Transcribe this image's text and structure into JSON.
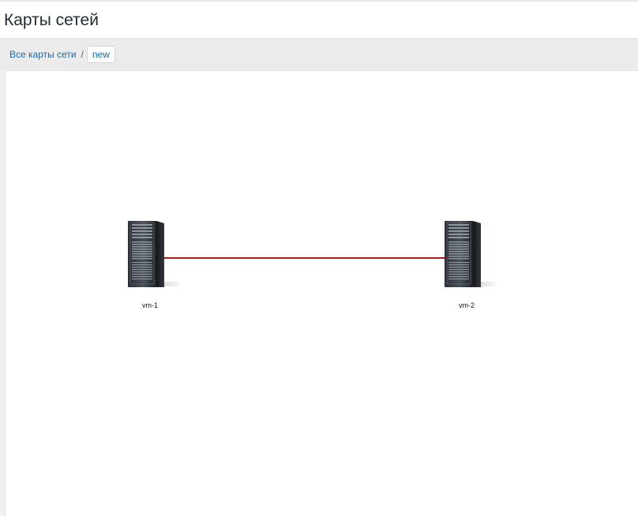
{
  "page": {
    "title": "Карты сетей"
  },
  "breadcrumb": {
    "all_maps": "Все карты сети",
    "separator": "/",
    "current": "new"
  },
  "map": {
    "link_color": "#b51818",
    "hosts": [
      {
        "label": "vm-1",
        "icon": "server-icon"
      },
      {
        "label": "vm-2",
        "icon": "server-icon"
      }
    ]
  }
}
